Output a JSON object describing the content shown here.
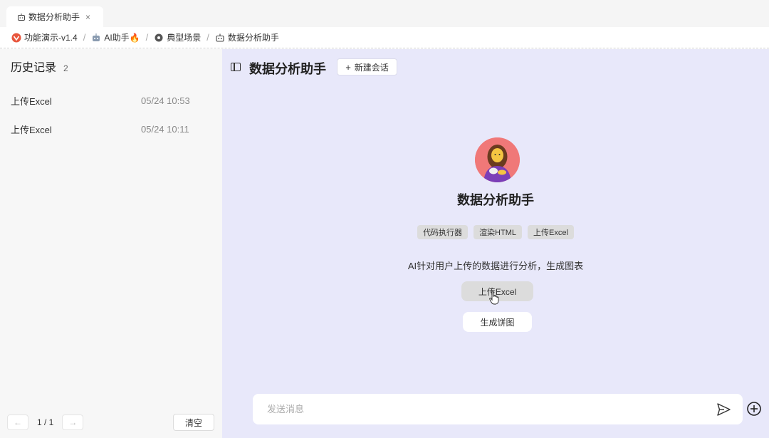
{
  "tab": {
    "label": "数据分析助手",
    "close": "×",
    "icon": "robot-icon"
  },
  "breadcrumb": [
    {
      "label": "功能演示-v1.4",
      "icon": "app-logo-icon"
    },
    {
      "label": "AI助手🔥",
      "icon": "robot-icon"
    },
    {
      "label": "典型场景",
      "icon": "scene-icon"
    },
    {
      "label": "数据分析助手",
      "icon": "robot-icon"
    }
  ],
  "sidebar": {
    "title": "历史记录",
    "count": "2",
    "items": [
      {
        "name": "上传Excel",
        "time": "05/24 10:53"
      },
      {
        "name": "上传Excel",
        "time": "05/24 10:11"
      }
    ],
    "pager": {
      "prev": "←",
      "text": "1 / 1",
      "next": "→"
    },
    "clear_label": "清空"
  },
  "main": {
    "title": "数据分析助手",
    "new_chat": {
      "plus": "+",
      "label": "新建会话"
    },
    "agent_name": "数据分析助手",
    "tags": [
      "代码执行器",
      "渲染HTML",
      "上传Excel"
    ],
    "description": "AI针对用户上传的数据进行分析，生成图表",
    "suggestions": [
      "上传Excel",
      "生成饼图"
    ],
    "input_placeholder": "发送消息"
  },
  "colors": {
    "main_bg": "#e8e8fa",
    "sidebar_bg": "#f7f7f7",
    "avatar_bg": "#f07878"
  }
}
